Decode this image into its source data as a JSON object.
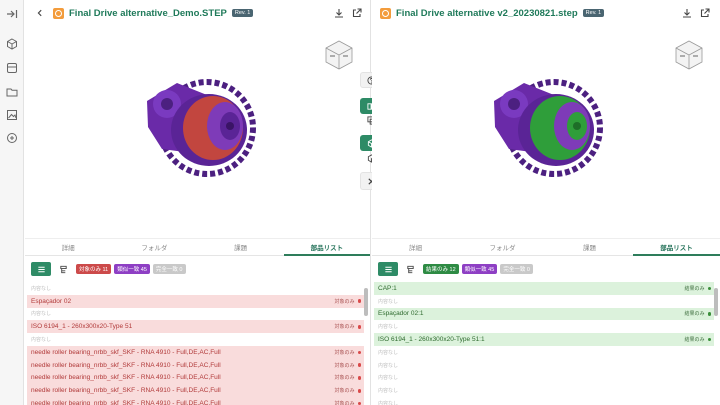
{
  "left": {
    "title": "Final Drive alternative_Demo.STEP",
    "rev": "Rev. 1",
    "tabs": [
      {
        "label": "詳細"
      },
      {
        "label": "フォルダ"
      },
      {
        "label": "課題"
      },
      {
        "label": "部品リスト",
        "active": true
      }
    ],
    "chips": [
      {
        "label": "対象のみ 11",
        "color": "#cc4a4a"
      },
      {
        "label": "類似一致 45",
        "color": "#8e3fc4"
      },
      {
        "label": "完全一致 0",
        "color": "#c9c9c9"
      }
    ],
    "rows": [
      {
        "empty": true,
        "label": "内容なし"
      },
      {
        "label": "Espaçador 02",
        "status": "対象のみ"
      },
      {
        "empty": true,
        "label": "内容なし"
      },
      {
        "label": "ISO 6194_1 - 260x300x20-Type 51",
        "status": "対象のみ"
      },
      {
        "empty": true,
        "label": "内容なし"
      },
      {
        "label": "needle roller bearing_nrbb_skf_SKF - RNA 4910 - Full,DE,AC,Full",
        "status": "対象のみ"
      },
      {
        "label": "needle roller bearing_nrbb_skf_SKF - RNA 4910 - Full,DE,AC,Full",
        "status": "対象のみ"
      },
      {
        "label": "needle roller bearing_nrbb_skf_SKF - RNA 4910 - Full,DE,AC,Full",
        "status": "対象のみ"
      },
      {
        "label": "needle roller bearing_nrbb_skf_SKF - RNA 4910 - Full,DE,AC,Full",
        "status": "対象のみ"
      },
      {
        "label": "needle roller bearing_nrbb_skf_SKF - RNA 4910 - Full,DE,AC,Full",
        "status": "対象のみ"
      }
    ]
  },
  "right": {
    "title": "Final Drive alternative v2_20230821.step",
    "rev": "Rev. 1",
    "tabs": [
      {
        "label": "詳細"
      },
      {
        "label": "フォルダ"
      },
      {
        "label": "課題"
      },
      {
        "label": "部品リスト",
        "active": true
      }
    ],
    "chips": [
      {
        "label": "結果のみ 12",
        "color": "#2e8b44"
      },
      {
        "label": "類似一致 45",
        "color": "#8e3fc4"
      },
      {
        "label": "完全一致 0",
        "color": "#c9c9c9"
      }
    ],
    "rows": [
      {
        "label": "CAP:1",
        "status": "結果のみ"
      },
      {
        "empty": true,
        "label": "内容なし"
      },
      {
        "label": "Espaçador 02:1",
        "status": "結果のみ"
      },
      {
        "empty": true,
        "label": "内容なし"
      },
      {
        "label": "ISO 6194_1 - 260x300x20-Type 51:1",
        "status": "結果のみ"
      },
      {
        "empty": true,
        "label": "内容なし"
      },
      {
        "empty": true,
        "label": "内容なし"
      },
      {
        "empty": true,
        "label": "内容なし"
      },
      {
        "empty": true,
        "label": "内容なし"
      },
      {
        "empty": true,
        "label": "内容なし"
      }
    ]
  },
  "colors": {
    "accent": "#2e8b66",
    "title": "#1f7a5a",
    "purple": "#6a2aa8",
    "red": "#c2463f",
    "green": "#2f9e3a"
  },
  "icons": {
    "rail": [
      "collapse-icon",
      "cube-icon",
      "box-icon",
      "folder-icon",
      "image-icon",
      "compare-icon"
    ],
    "mid": [
      "help-icon",
      "split-view-icon",
      "overlay-icon",
      "cube-color-icon",
      "cube-outline-icon",
      "close-icon"
    ]
  }
}
